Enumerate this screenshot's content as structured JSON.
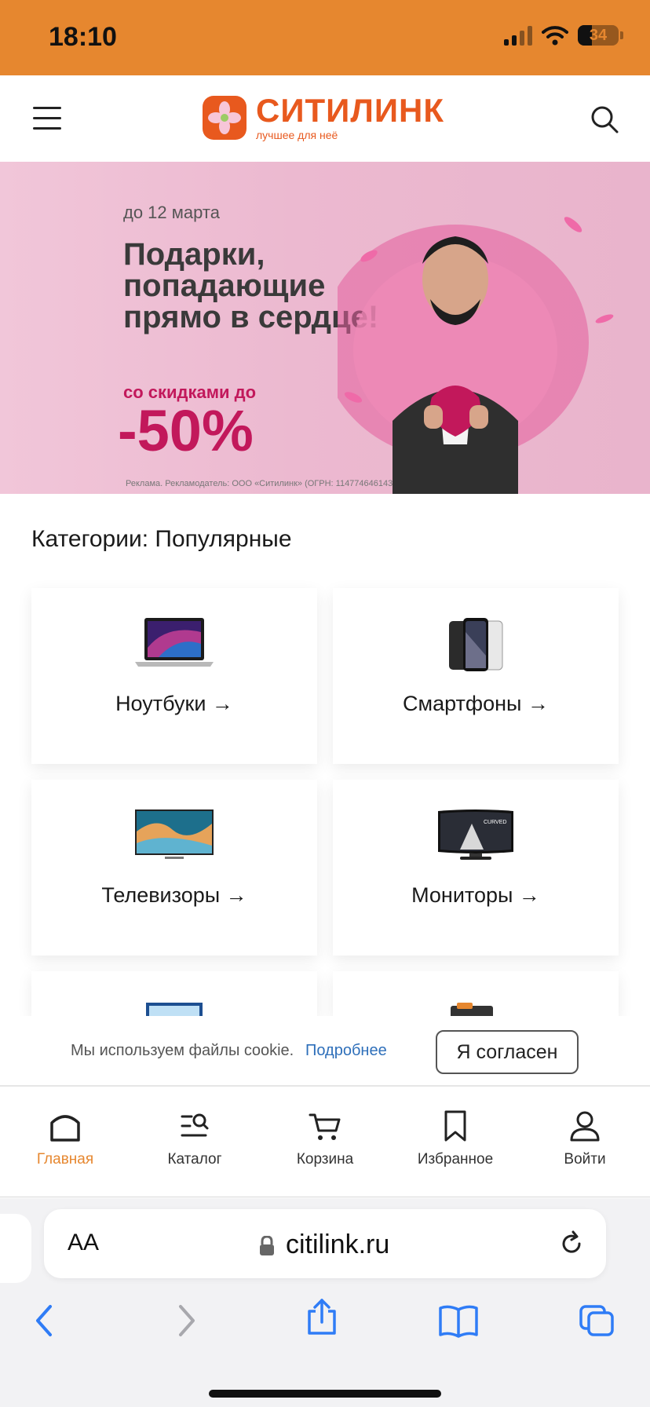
{
  "status_bar": {
    "time": "18:10",
    "battery": "34"
  },
  "header": {
    "logo_name": "СИТИЛИНК",
    "logo_tagline": "лучшее для неё"
  },
  "banner": {
    "date": "до 12 марта",
    "headline": "Подарки, попадающие прямо в сердце!",
    "discount_label": "со скидками до",
    "discount_value": "-50%",
    "disclaimer": "Реклама. Рекламодатель: ООО «Ситилинк» (ОГРН: 1147746461433)"
  },
  "categories": {
    "title": "Категории: Популярные",
    "items": [
      {
        "label": "Ноутбуки →"
      },
      {
        "label": "Смартфоны →"
      },
      {
        "label": "Телевизоры →"
      },
      {
        "label": "Мониторы →"
      }
    ]
  },
  "cookie": {
    "text": "Мы используем файлы cookie.",
    "link": "Подробнее",
    "accept": "Я согласен"
  },
  "tabbar": {
    "items": [
      {
        "label": "Главная",
        "active": true
      },
      {
        "label": "Каталог"
      },
      {
        "label": "Корзина"
      },
      {
        "label": "Избранное"
      },
      {
        "label": "Войти"
      }
    ]
  },
  "browser": {
    "aa": "AA",
    "url": "citilink.ru"
  },
  "colors": {
    "status_bar": "#e6872f",
    "brand": "#e8591e",
    "active_tab": "#e6872f",
    "link": "#2e6fba"
  }
}
